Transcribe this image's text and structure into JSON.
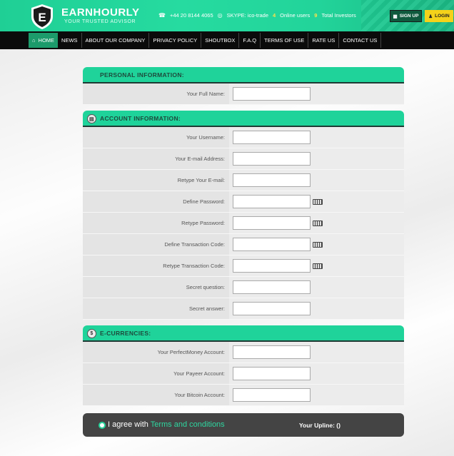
{
  "header": {
    "logo_letter": "E",
    "brand": "EARNHOURLY",
    "tagline": "YOUR TRUSTED ADVISOR",
    "phone": "+44 20 8144 4065",
    "skype": "SKYPE: ico-trade",
    "online_count": "4",
    "online_label": "Online users",
    "investors_count": "9",
    "investors_label": "Total Investors",
    "signup_label": "SIGN UP",
    "login_label": "LOGIN"
  },
  "nav": {
    "items": [
      "HOME",
      "NEWS",
      "ABOUT OUR COMPANY",
      "PRIVACY POLICY",
      "SHOUTBOX",
      "F.A.Q",
      "TERMS OF USE",
      "RATE US",
      "CONTACT US"
    ]
  },
  "personal": {
    "title": "PERSONAL INFORMATION:",
    "fields": [
      {
        "label": "Your Full Name:",
        "value": ""
      }
    ]
  },
  "account": {
    "title": "ACCOUNT INFORMATION:",
    "fields": [
      {
        "label": "Your Username:",
        "value": ""
      },
      {
        "label": "Your E-mail Address:",
        "value": ""
      },
      {
        "label": "Retype Your E-mail:",
        "value": ""
      },
      {
        "label": "Define Password:",
        "value": ""
      },
      {
        "label": "Retype Password:",
        "value": ""
      },
      {
        "label": "Define Transaction Code:",
        "value": ""
      },
      {
        "label": "Retype Transaction Code:",
        "value": ""
      },
      {
        "label": "Secret question:",
        "value": ""
      },
      {
        "label": "Secret answer:",
        "value": ""
      }
    ]
  },
  "currencies": {
    "title": "E-CURRENCIES:",
    "fields": [
      {
        "label": "Your PerfectMoney Account:",
        "value": ""
      },
      {
        "label": "Your Payeer Account:",
        "value": ""
      },
      {
        "label": "Your Bitcoin Account:",
        "value": ""
      }
    ]
  },
  "agreement": {
    "prefix": "I agree with",
    "link_text": "Terms and conditions",
    "upline_label": "Your Upline: ()"
  },
  "colors": {
    "accent": "#1fd39a",
    "nav_bg": "#0b0b0b",
    "login_yellow": "#f4d21a"
  }
}
